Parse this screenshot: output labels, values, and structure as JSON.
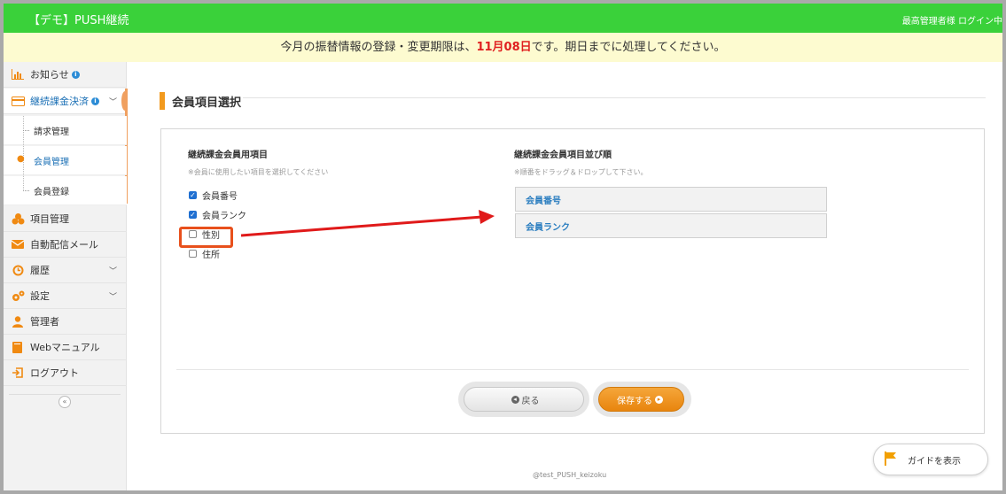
{
  "header": {
    "brand": "【デモ】PUSH継続",
    "login_status": "最高管理者様 ログイン中",
    "brand_color": "#3ad13a"
  },
  "notice": {
    "before": "今月の振替情報の登録・変更期限は、",
    "date": "11月08日",
    "after": "です。期日までに処理してください。"
  },
  "sidebar": {
    "items": [
      {
        "label": "お知らせ",
        "icon": "bar-chart-icon"
      },
      {
        "label": "継続課金決済",
        "icon": "card-icon"
      },
      {
        "label": "項目管理",
        "icon": "cubes-icon"
      },
      {
        "label": "自動配信メール",
        "icon": "mail-icon"
      },
      {
        "label": "履歴",
        "icon": "history-icon"
      },
      {
        "label": "設定",
        "icon": "gears-icon"
      },
      {
        "label": "管理者",
        "icon": "user-icon"
      },
      {
        "label": "Webマニュアル",
        "icon": "book-icon"
      },
      {
        "label": "ログアウト",
        "icon": "logout-icon"
      }
    ],
    "sub_items": [
      {
        "label": "請求管理"
      },
      {
        "label": "会員管理"
      },
      {
        "label": "会員登録"
      }
    ],
    "collapse_glyph": "«"
  },
  "main": {
    "section_title": "会員項目選択",
    "left": {
      "heading": "継続課金会員用項目",
      "note": "※会員に使用したい項目を選択してください",
      "checkboxes": [
        {
          "label": "会員番号",
          "checked": true
        },
        {
          "label": "会員ランク",
          "checked": true
        },
        {
          "label": "性別",
          "checked": false
        },
        {
          "label": "住所",
          "checked": false
        }
      ]
    },
    "right": {
      "heading": "継続課金会員項目並び順",
      "note": "※順番をドラッグ＆ドロップして下さい。",
      "items": [
        {
          "label": "会員番号"
        },
        {
          "label": "会員ランク"
        }
      ]
    },
    "buttons": {
      "back_label": "戻る",
      "save_label": "保存する"
    },
    "footer": "@test_PUSH_keizoku",
    "guide_label": "ガイドを表示"
  },
  "colors": {
    "accent_orange": "#f29a1e",
    "annotation_red": "#e02020",
    "link_blue": "#2b7ec0"
  }
}
